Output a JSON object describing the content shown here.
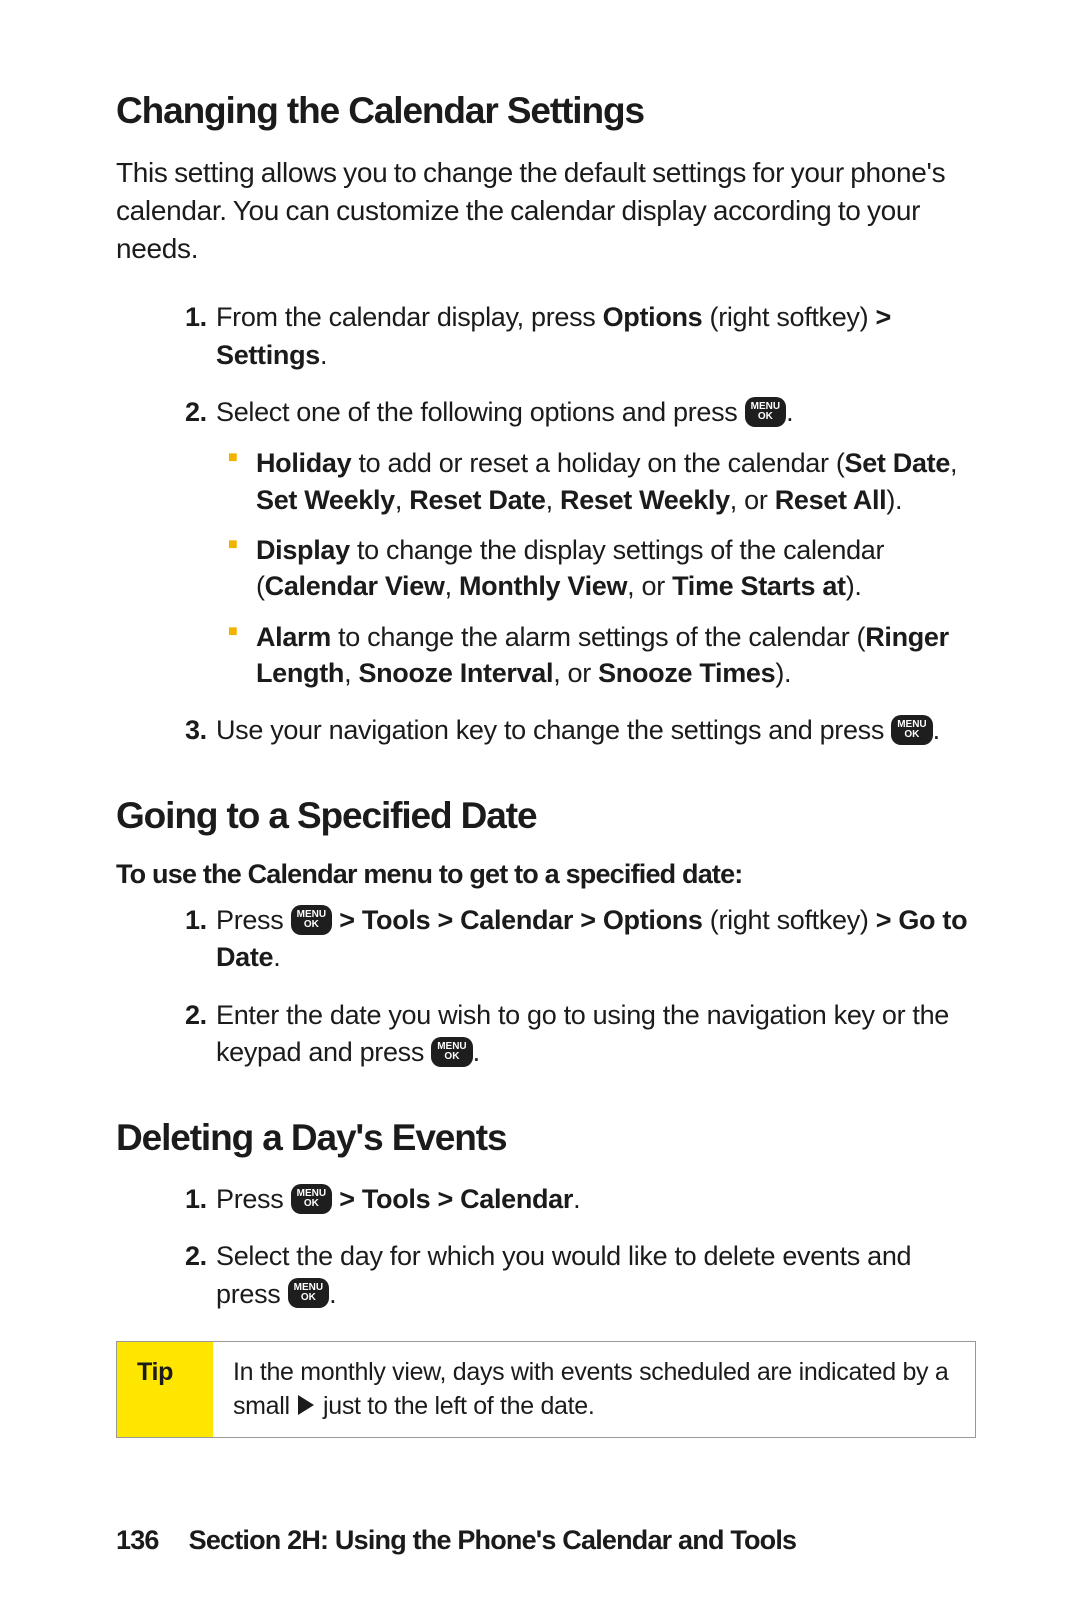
{
  "section1": {
    "heading": "Changing the Calendar Settings",
    "intro": "This setting allows you to change the default settings for your phone's calendar. You can customize the calendar display according to your needs.",
    "step1_a": "From the calendar display, press ",
    "step1_b": "Options",
    "step1_c": " (right softkey) ",
    "step1_d": "> Settings",
    "step1_e": ".",
    "step2": "Select one of the following options and press ",
    "b1_head": "Holiday",
    "b1_tail_a": " to add or reset a holiday on the calendar (",
    "b1_tail_b": "Set Date",
    "b1_tail_c": ", ",
    "b1_tail_d": "Set Weekly",
    "b1_tail_e": ", ",
    "b1_tail_f": "Reset Date",
    "b1_tail_g": ", ",
    "b1_tail_h": "Reset Weekly",
    "b1_tail_i": ", or ",
    "b1_tail_j": "Reset All",
    "b1_tail_k": ").",
    "b2_head": "Display",
    "b2_tail_a": " to change the display settings of the calendar (",
    "b2_tail_b": "Calendar View",
    "b2_tail_c": ", ",
    "b2_tail_d": "Monthly View",
    "b2_tail_e": ", or ",
    "b2_tail_f": "Time Starts at",
    "b2_tail_g": ").",
    "b3_head": "Alarm",
    "b3_tail_a": " to change the alarm settings of the calendar (",
    "b3_tail_b": "Ringer Length",
    "b3_tail_c": ", ",
    "b3_tail_d": "Snooze Interval",
    "b3_tail_e": ", or ",
    "b3_tail_f": "Snooze Times",
    "b3_tail_g": ").",
    "step3_a": "Use your navigation key to change the settings and press ",
    "step3_b": "."
  },
  "section2": {
    "heading": "Going to a Specified Date",
    "subhead": "To use the Calendar menu to get to a specified date:",
    "step1_a": "Press ",
    "step1_b": " > Tools > Calendar > Options",
    "step1_c": " (right softkey) ",
    "step1_d": "> Go to Date",
    "step1_e": ".",
    "step2_a": "Enter the date you wish to go to using the navigation key or the keypad and press ",
    "step2_b": "."
  },
  "section3": {
    "heading": "Deleting a Day's Events",
    "step1_a": "Press ",
    "step1_b": " > Tools > Calendar",
    "step1_c": ".",
    "step2_a": "Select the day for which you would like to delete events and press ",
    "step2_b": "."
  },
  "tip": {
    "label": "Tip",
    "text_a": "In the monthly view, days with events scheduled are indicated by a small ",
    "text_b": " just to the left of the date."
  },
  "key": {
    "top": "MENU",
    "bot": "OK"
  },
  "footer": {
    "page": "136",
    "text": "Section 2H: Using the Phone's Calendar and Tools"
  }
}
